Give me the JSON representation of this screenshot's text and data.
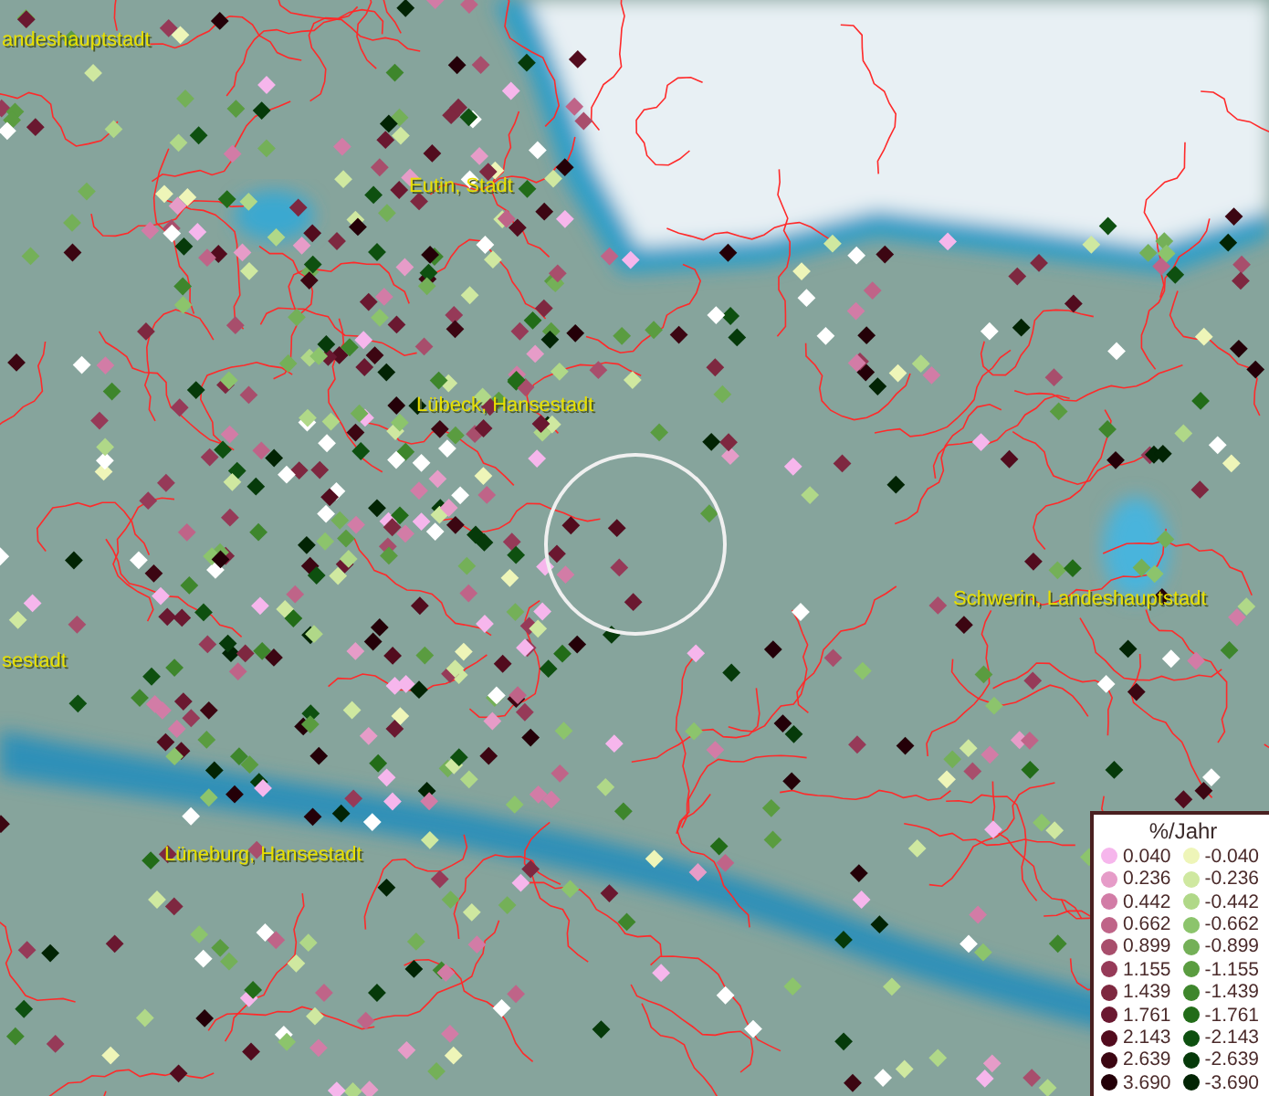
{
  "map": {
    "labels": [
      {
        "text": "andeshauptstadt"
      },
      {
        "text": "Eutin, Stadt"
      },
      {
        "text": "Lübeck, Hansestadt"
      },
      {
        "text": "Schwerin, Landeshauptstadt"
      },
      {
        "text": "sestadt"
      },
      {
        "text": "Lüneburg, Hansestadt"
      }
    ]
  },
  "legend": {
    "title": "%/Jahr",
    "positive": [
      {
        "value": "0.040",
        "color": "#f6b6ec"
      },
      {
        "value": "0.236",
        "color": "#e69cc8"
      },
      {
        "value": "0.442",
        "color": "#d27ca6"
      },
      {
        "value": "0.662",
        "color": "#bf6488"
      },
      {
        "value": "0.899",
        "color": "#a84e6c"
      },
      {
        "value": "1.155",
        "color": "#963a58"
      },
      {
        "value": "1.439",
        "color": "#7e2840"
      },
      {
        "value": "1.761",
        "color": "#6a1830"
      },
      {
        "value": "2.143",
        "color": "#520c1e"
      },
      {
        "value": "2.639",
        "color": "#3c0612"
      },
      {
        "value": "3.690",
        "color": "#240008"
      }
    ],
    "negative": [
      {
        "value": "-0.040",
        "color": "#eef5b8"
      },
      {
        "value": "-0.236",
        "color": "#cfe8a0"
      },
      {
        "value": "-0.442",
        "color": "#b0d888"
      },
      {
        "value": "-0.662",
        "color": "#8cc46c"
      },
      {
        "value": "-0.899",
        "color": "#74b058"
      },
      {
        "value": "-1.155",
        "color": "#5a9c40"
      },
      {
        "value": "-1.439",
        "color": "#3e862c"
      },
      {
        "value": "-1.761",
        "color": "#226c18"
      },
      {
        "value": "-2.143",
        "color": "#0e5010"
      },
      {
        "value": "-2.639",
        "color": "#063a0a"
      },
      {
        "value": "-3.690",
        "color": "#022404"
      }
    ]
  }
}
